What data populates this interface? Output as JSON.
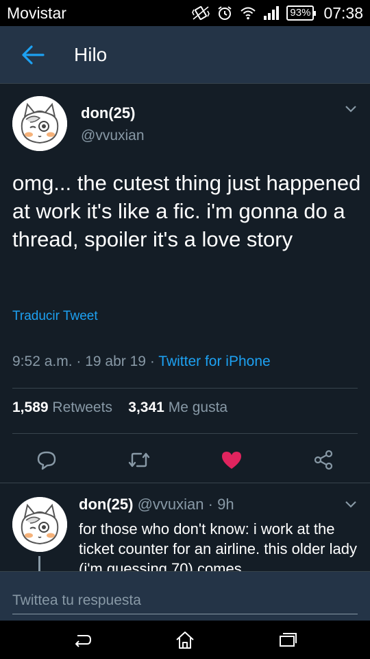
{
  "status_bar": {
    "carrier": "Movistar",
    "battery": "93%",
    "time": "07:38"
  },
  "header": {
    "title": "Hilo"
  },
  "tweet": {
    "author_name": "don(25)",
    "author_handle": "@vvuxian",
    "text": "omg... the cutest thing just happened at work it's like a fic. i'm gonna do a thread, spoiler it's a love story",
    "translate_label": "Traducir Tweet",
    "time": "9:52 a.m.",
    "date": "19 abr 19",
    "client": "Twitter for iPhone",
    "retweet_count": "1,589",
    "retweet_label": "Retweets",
    "like_count": "3,341",
    "like_label": "Me gusta",
    "liked": true
  },
  "reply": {
    "author_name": "don(25)",
    "author_handle": "@vvuxian",
    "age": "9h",
    "text": "for those who don't know: i work at the ticket counter for an airline. this older lady (i'm guessing 70) comes"
  },
  "compose": {
    "placeholder": "Twittea tu respuesta"
  },
  "colors": {
    "background": "#141d26",
    "header": "#243447",
    "accent": "#1da1f2",
    "muted": "#8899a6",
    "like": "#e0245e"
  }
}
